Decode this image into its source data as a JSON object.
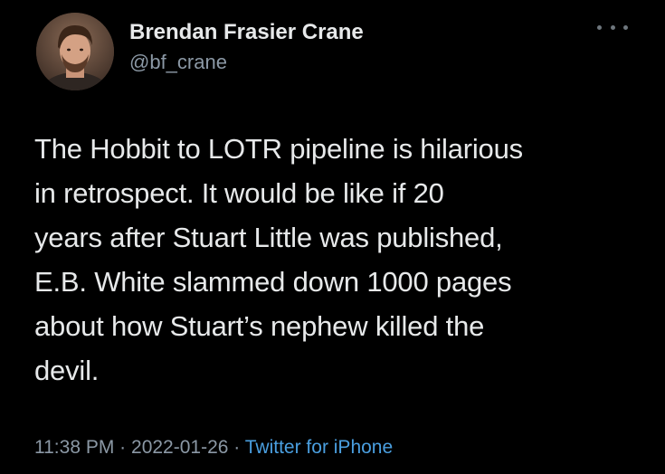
{
  "author": {
    "display_name": "Brendan Frasier Crane",
    "handle": "@bf_crane",
    "avatar_icon": "profile-photo"
  },
  "tweet": {
    "lines": [
      "The Hobbit to LOTR pipeline is hilarious",
      "in retrospect. It would be like if 20",
      "years after Stuart Little was published,",
      "E.B. White slammed down 1000 pages",
      "about how Stuart’s nephew killed the",
      "devil."
    ]
  },
  "meta": {
    "time": "11:38 PM",
    "separator": "·",
    "date": "2022-01-26",
    "source": "Twitter for iPhone"
  },
  "colors": {
    "background": "#000000",
    "primary_text": "#e7e9ea",
    "secondary_text": "#8b98a5",
    "link": "#4a9fe0"
  },
  "more_icon": "more-horizontal-icon"
}
